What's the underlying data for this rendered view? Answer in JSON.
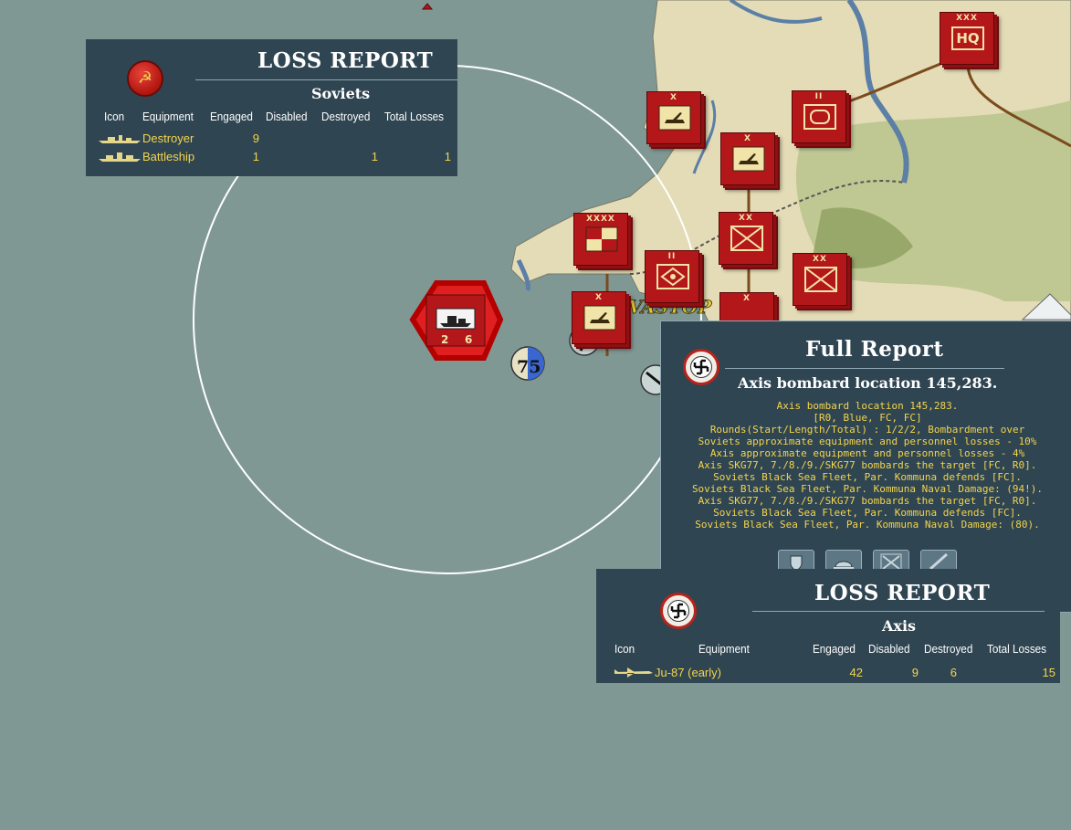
{
  "map": {
    "colors": {
      "sea": "#7f9894",
      "land": "#e3dcb6",
      "unit": "#b3171a"
    },
    "city_label": "VASTOP",
    "badge_value": "75",
    "hex_unit": {
      "attack": "2",
      "defense": "6"
    }
  },
  "counters": [
    {
      "name": "counter-hq",
      "size": "XXX",
      "type": "hq",
      "label": "HQ"
    },
    {
      "name": "counter-artillery-1",
      "size": "X",
      "type": "artillery"
    },
    {
      "name": "counter-armor",
      "size": "II",
      "type": "armor"
    },
    {
      "name": "counter-artillery-2",
      "size": "X",
      "type": "artillery"
    },
    {
      "name": "counter-army",
      "size": "XXXX",
      "type": "army"
    },
    {
      "name": "counter-infantry-1",
      "size": "XX",
      "type": "infantry"
    },
    {
      "name": "counter-recon",
      "size": "II",
      "type": "recon"
    },
    {
      "name": "counter-infantry-2",
      "size": "XX",
      "type": "infantry"
    },
    {
      "name": "counter-artillery-3",
      "size": "X",
      "type": "artillery"
    },
    {
      "name": "counter-partial",
      "size": "X",
      "type": "artillery"
    }
  ],
  "loss_report_soviets": {
    "title": "LOSS REPORT",
    "side": "Soviets",
    "emblem": "hammer-sickle-icon",
    "headers": [
      "Icon",
      "Equipment",
      "Engaged",
      "Disabled",
      "Destroyed",
      "Total Losses"
    ],
    "rows": [
      {
        "equipment": "Destroyer",
        "engaged": "9",
        "disabled": "",
        "destroyed": "",
        "total": ""
      },
      {
        "equipment": "Battleship",
        "engaged": "1",
        "disabled": "",
        "destroyed": "1",
        "total": "1"
      }
    ]
  },
  "full_report": {
    "title": "Full Report",
    "subtitle": "Axis bombard location 145,283.",
    "emblem": "swastika-roundel-icon",
    "lines": [
      "Axis bombard location 145,283.",
      "[R0, Blue, FC, FC]",
      "Rounds(Start/Length/Total) : 1/2/2, Bombardment over",
      "Soviets approximate equipment and personnel losses - 10%",
      "Axis approximate equipment and personnel losses - 4%",
      "Axis SKG77, 7./8./9./SKG77 bombards the target [FC, R0].",
      "Soviets Black Sea Fleet, Par. Kommuna defends [FC].",
      "Soviets Black Sea Fleet, Par. Kommuna Naval Damage: (94!).",
      "Axis SKG77, 7./8./9./SKG77 bombards the target [FC, R0].",
      "Soviets Black Sea Fleet, Par. Kommuna defends [FC].",
      "Soviets Black Sea Fleet, Par. Kommuna Naval Damage: (80)."
    ],
    "buttons": [
      "shield-icon",
      "helmet-icon",
      "crossed-swords-icon",
      "sword-icon"
    ]
  },
  "loss_report_axis": {
    "title": "LOSS REPORT",
    "side": "Axis",
    "emblem": "swastika-roundel-icon",
    "headers": [
      "Icon",
      "Equipment",
      "Engaged",
      "Disabled",
      "Destroyed",
      "Total Losses"
    ],
    "rows": [
      {
        "equipment": "Ju-87 (early)",
        "engaged": "42",
        "disabled": "9",
        "destroyed": "6",
        "total": "15"
      }
    ]
  }
}
